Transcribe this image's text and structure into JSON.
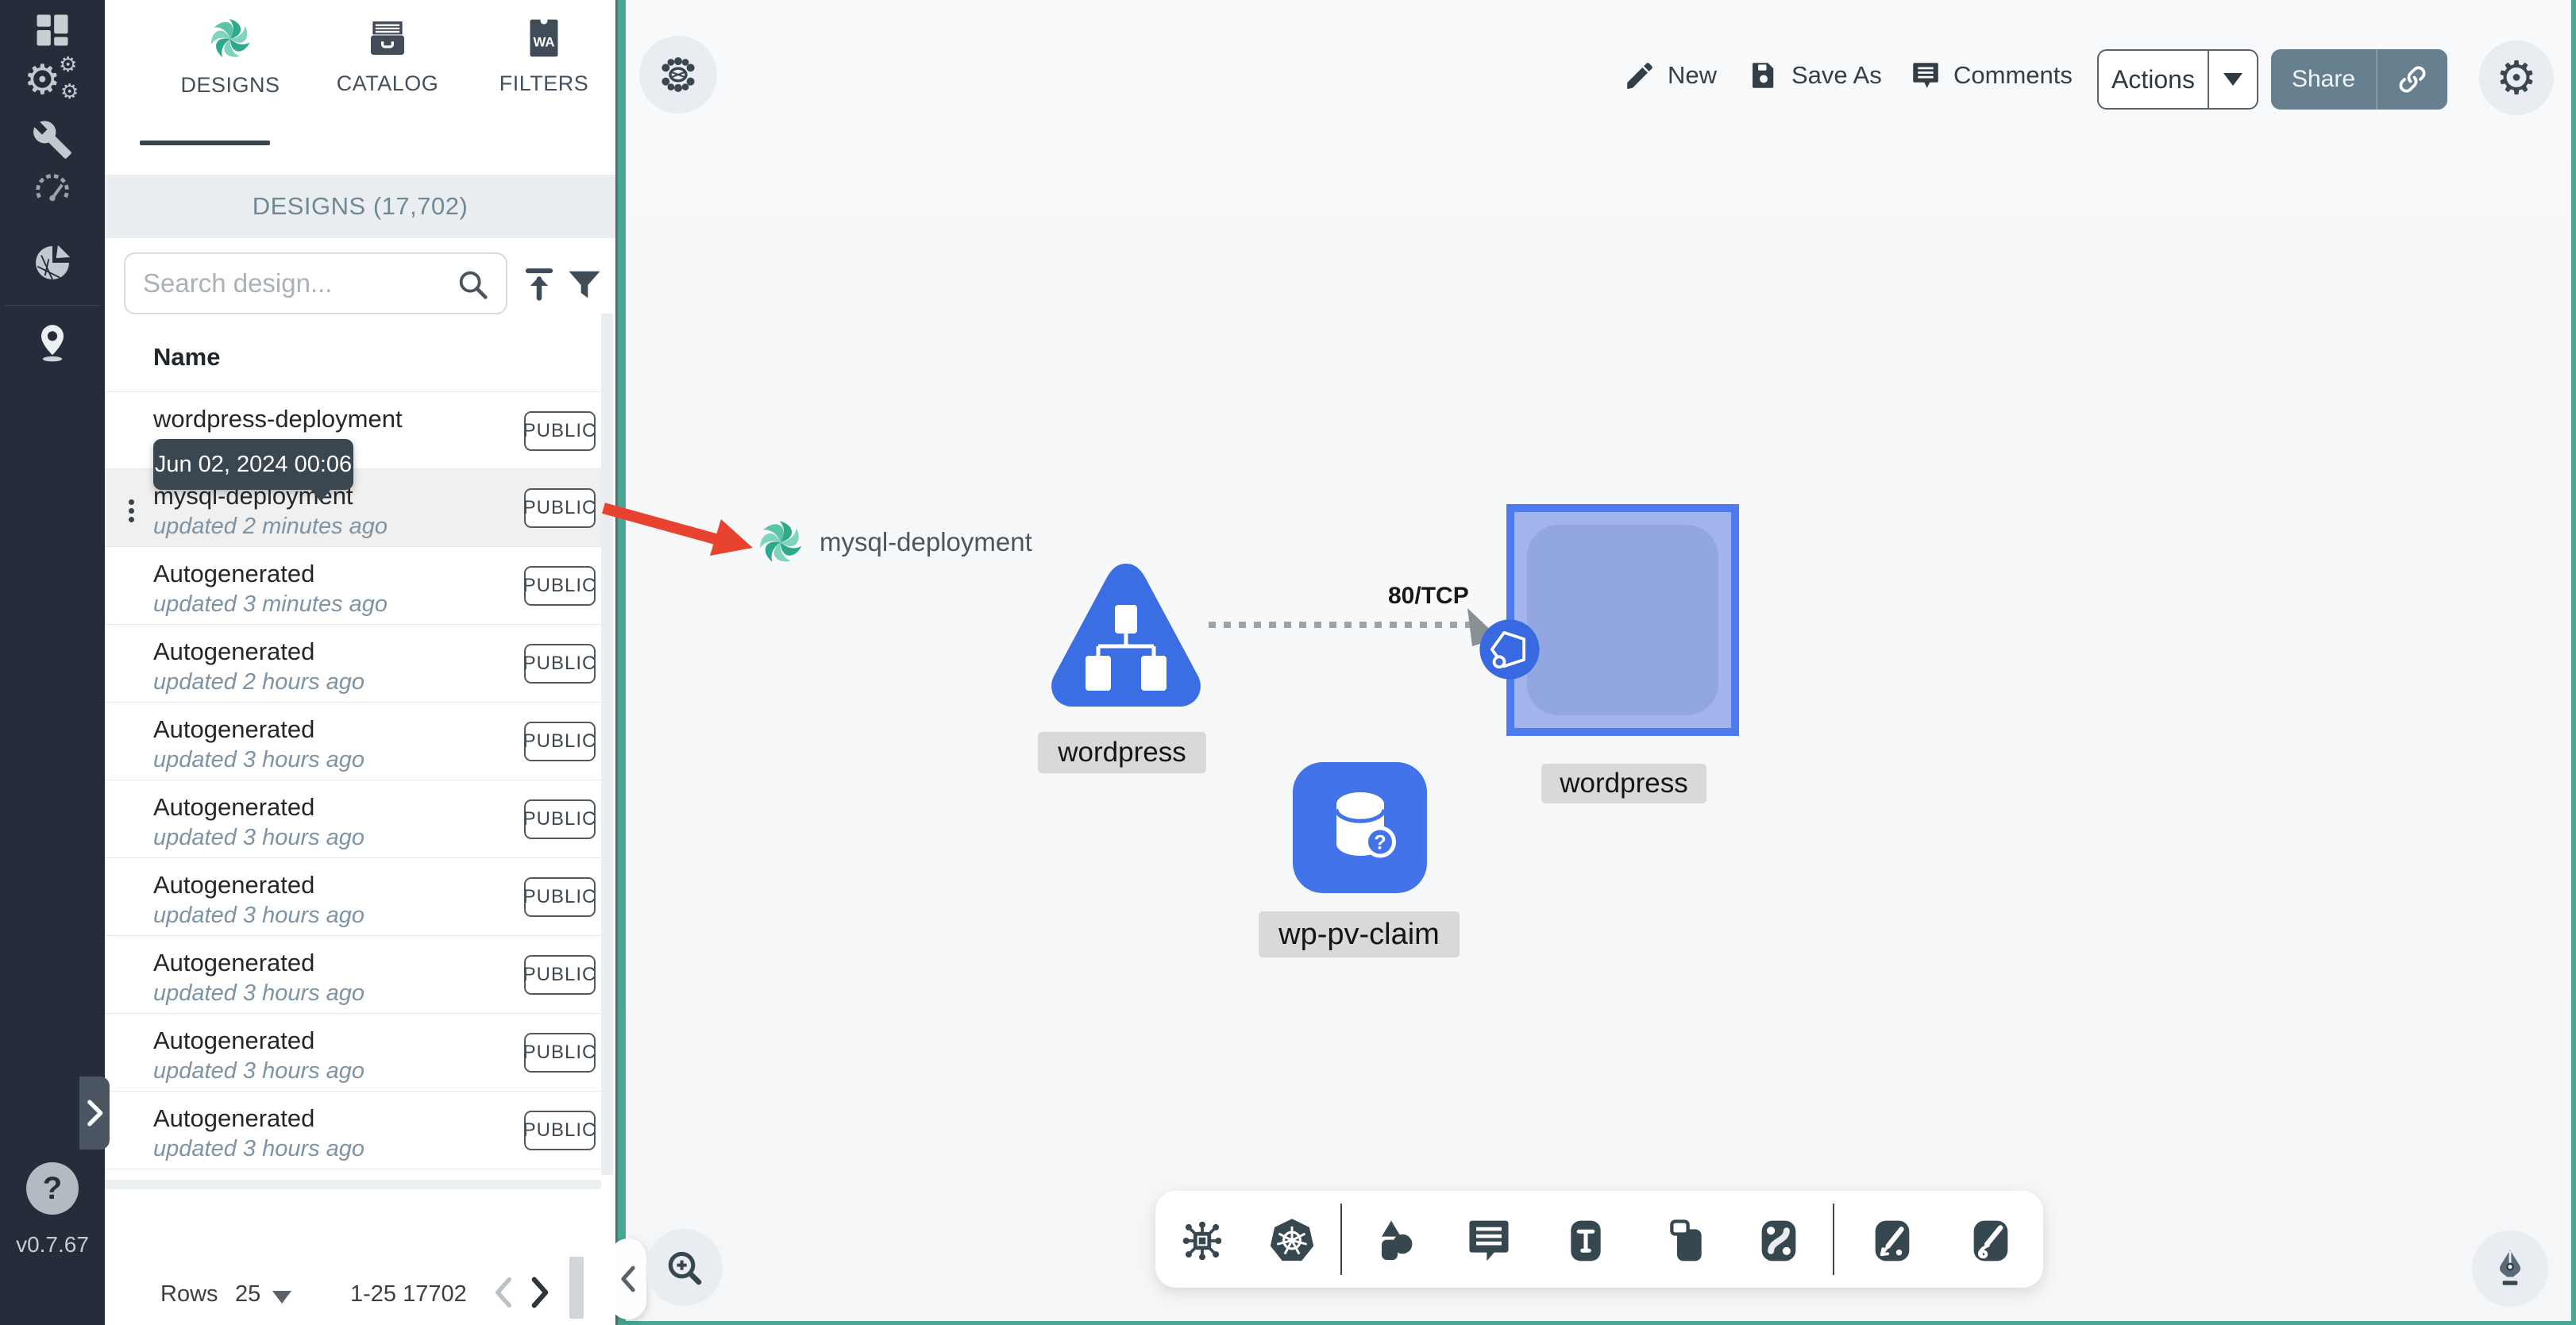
{
  "app": {
    "version": "v0.7.67"
  },
  "icons": {
    "gear": "⚙",
    "help": "?",
    "sidebar_gear_main": "⚙",
    "sidebar_gear_small": "⚙"
  },
  "sidebar": {
    "items": [
      {
        "name": "dashboard"
      },
      {
        "name": "lifecycle"
      },
      {
        "name": "configuration"
      },
      {
        "name": "performance"
      },
      {
        "name": "extensions"
      },
      {
        "name": "kanvas-pin"
      }
    ]
  },
  "panel": {
    "tabs": [
      {
        "label": "DESIGNS",
        "active": true
      },
      {
        "label": "CATALOG",
        "active": false
      },
      {
        "label": "FILTERS",
        "active": false
      }
    ],
    "header": "DESIGNS (17,702)",
    "search": {
      "placeholder": "Search design...",
      "value": ""
    },
    "columns": {
      "name": "Name"
    },
    "tooltip": "Jun 02, 2024 00:06",
    "rows": [
      {
        "name": "wordpress-deployment",
        "updated": "",
        "badge": "PUBLIC",
        "hover": false
      },
      {
        "name": "mysql-deployment",
        "updated": "updated 2 minutes ago",
        "badge": "PUBLIC",
        "hover": true
      },
      {
        "name": "Autogenerated",
        "updated": "updated 3 minutes ago",
        "badge": "PUBLIC",
        "hover": false
      },
      {
        "name": "Autogenerated",
        "updated": "updated 2 hours ago",
        "badge": "PUBLIC",
        "hover": false
      },
      {
        "name": "Autogenerated",
        "updated": "updated 3 hours ago",
        "badge": "PUBLIC",
        "hover": false
      },
      {
        "name": "Autogenerated",
        "updated": "updated 3 hours ago",
        "badge": "PUBLIC",
        "hover": false
      },
      {
        "name": "Autogenerated",
        "updated": "updated 3 hours ago",
        "badge": "PUBLIC",
        "hover": false
      },
      {
        "name": "Autogenerated",
        "updated": "updated 3 hours ago",
        "badge": "PUBLIC",
        "hover": false
      },
      {
        "name": "Autogenerated",
        "updated": "updated 3 hours ago",
        "badge": "PUBLIC",
        "hover": false
      },
      {
        "name": "Autogenerated",
        "updated": "updated 3 hours ago",
        "badge": "PUBLIC",
        "hover": false
      }
    ],
    "pagination": {
      "rows_label": "Rows",
      "per_page": "25",
      "range": "1-25 17702"
    }
  },
  "toolbar": {
    "new_label": "New",
    "save_as_label": "Save As",
    "comments_label": "Comments",
    "actions_label": "Actions",
    "share_label": "Share"
  },
  "canvas": {
    "drag_item": "mysql-deployment",
    "edge": {
      "label": "80/TCP"
    },
    "nodes": [
      {
        "type": "deployment",
        "label": "wordpress"
      },
      {
        "type": "service",
        "label": "wordpress"
      },
      {
        "type": "persistent-volume-claim",
        "label": "wp-pv-claim"
      }
    ]
  },
  "colors": {
    "teal_border": "#48A794",
    "rail_bg": "#242D39",
    "kubernetes_blue": "#3B6EE3",
    "service_border": "#4D7AEC",
    "red_arrow": "#E8432F",
    "share_button": "#66808F",
    "tooltip_bg": "#3A4750",
    "label_bg": "#D9D9D9"
  }
}
